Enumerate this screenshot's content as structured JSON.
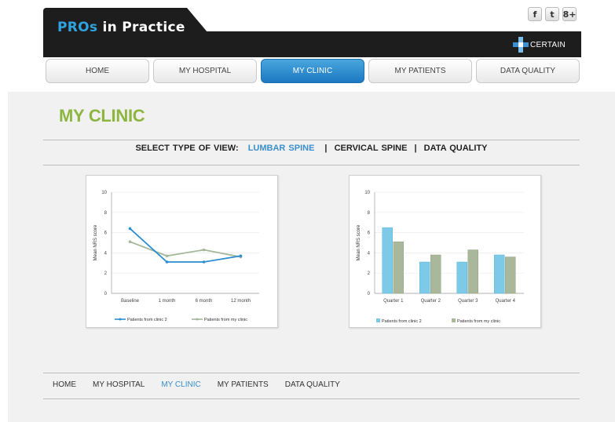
{
  "brand": {
    "logo_pros": "PROs",
    "logo_rest": " in Practice",
    "partner": "CERTAIN"
  },
  "social": [
    "f",
    "t",
    "8+"
  ],
  "nav": {
    "items": [
      "HOME",
      "MY HOSPITAL",
      "MY CLINIC",
      "MY PATIENTS",
      "DATA QUALITY"
    ],
    "active_index": 2
  },
  "page_title": "MY CLINIC",
  "view_selector": {
    "label": "SELECT TYPE OF VIEW:",
    "options": [
      "LUMBAR SPINE",
      "CERVICAL SPINE",
      "DATA QUALITY"
    ],
    "selected_index": 0
  },
  "colors": {
    "accent_blue": "#2a8fd0",
    "series_b": "#a5b89a",
    "title_green": "#8db641"
  },
  "chart_data": [
    {
      "type": "line",
      "x": [
        "Baseline",
        "1 month",
        "6 month",
        "12 month"
      ],
      "ylabel": "Mean NRS score",
      "ylim": [
        0,
        10
      ],
      "yticks": [
        0,
        2,
        4,
        6,
        8,
        10
      ],
      "series": [
        {
          "name": "Patients from clinic 2",
          "values": [
            6.4,
            3.1,
            3.1,
            3.7
          ],
          "color": "#2a8fd0"
        },
        {
          "name": "Patients from my clinic",
          "values": [
            5.1,
            3.7,
            4.3,
            3.6
          ],
          "color": "#a5b89a"
        }
      ],
      "legend": "bottom"
    },
    {
      "type": "bar",
      "categories": [
        "Quarter 1",
        "Quarter 2",
        "Quarter 3",
        "Quarter 4"
      ],
      "ylabel": "Mean NRS score",
      "ylim": [
        0,
        10
      ],
      "yticks": [
        0,
        2,
        4,
        6,
        8,
        10
      ],
      "series": [
        {
          "name": "Patients from clinic 2",
          "values": [
            6.5,
            3.1,
            3.1,
            3.8
          ],
          "color": "#7cc9e8"
        },
        {
          "name": "Patients from my clinic",
          "values": [
            5.1,
            3.8,
            4.3,
            3.6
          ],
          "color": "#a9b79b"
        }
      ],
      "legend": "bottom"
    }
  ]
}
